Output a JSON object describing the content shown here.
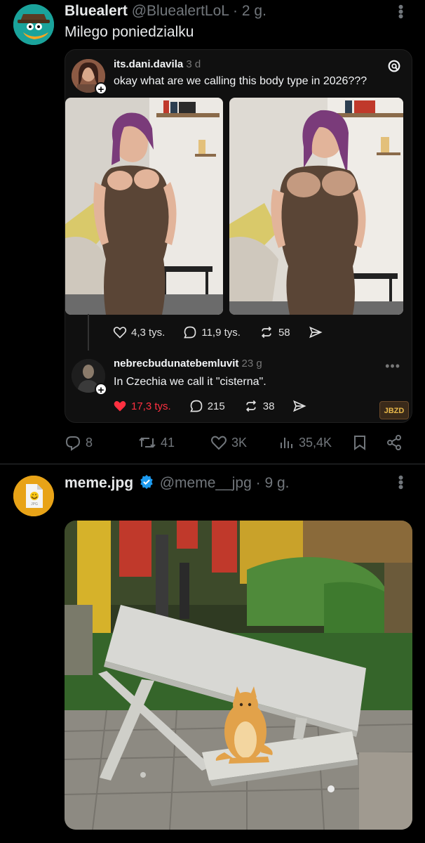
{
  "post1": {
    "author_name": "Bluealert",
    "author_handle": "@BluealertLoL",
    "separator": "·",
    "time": "2 g.",
    "text": "Milego poniedzialku",
    "quote": {
      "username": "its.dani.davila",
      "time": "3 d",
      "text": "okay what are we calling this body type in 2026???",
      "likes": "4,3 tys.",
      "replies": "11,9 tys.",
      "reposts": "58",
      "reply": {
        "username": "nebrecbudunatebemluvit",
        "time": "23 g",
        "text": "In Czechia we call it \"cisterna\".",
        "likes": "17,3 tys.",
        "replies": "215",
        "reposts": "38"
      },
      "watermark": "JBZD"
    },
    "actions": {
      "replies": "8",
      "retweets": "41",
      "likes": "3K",
      "views": "35,4K"
    }
  },
  "post2": {
    "author_name": "meme.jpg",
    "author_handle": "@meme__jpg",
    "separator": "·",
    "time": "9 g.",
    "avatar_label": "JPG"
  },
  "colors": {
    "background": "#000000",
    "text_primary": "#e7e9ea",
    "text_secondary": "#71767b",
    "verified": "#1d9bf0",
    "liked_red": "#ff3040"
  }
}
